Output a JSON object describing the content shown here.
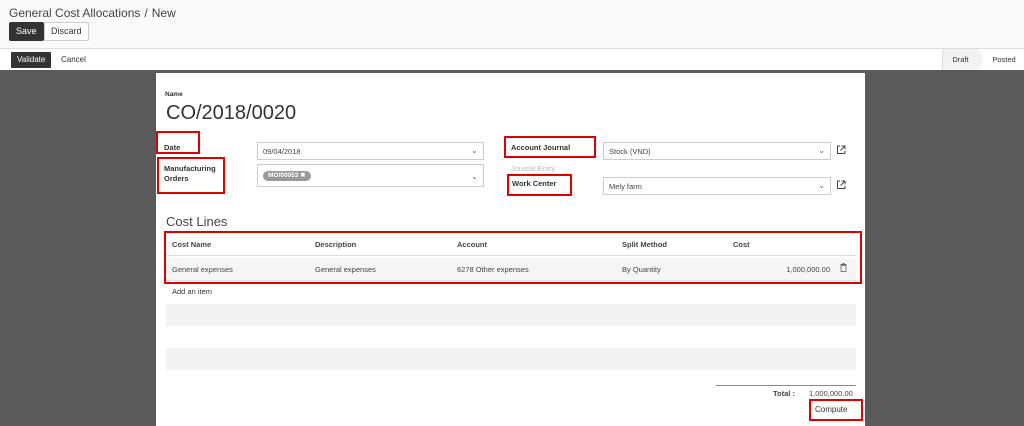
{
  "breadcrumb": {
    "parent": "General Cost Allocations",
    "separator": "/",
    "current": "New"
  },
  "buttons": {
    "save": "Save",
    "discard": "Discard",
    "validate": "Validate",
    "cancel": "Cancel",
    "compute": "Compute"
  },
  "status_stages": [
    "Draft",
    "Posted"
  ],
  "form": {
    "name_label": "Name",
    "name_value": "CO/2018/0020",
    "date_label": "Date",
    "date_value": "09/04/2018",
    "mo_label_line1": "Manufacturing",
    "mo_label_line2": "Orders",
    "mo_tag": "MO/00053",
    "account_journal_label": "Account Journal",
    "account_journal_value": "Stock (VND)",
    "journal_entry_label": "Journal Entry",
    "work_center_label": "Work Center",
    "work_center_value": "Mely farm"
  },
  "cost_lines": {
    "title": "Cost Lines",
    "columns": [
      "Cost Name",
      "Description",
      "Account",
      "Split Method",
      "Cost"
    ],
    "rows": [
      {
        "cost_name": "General expenses",
        "description": "General expenses",
        "account": "6278 Other expenses",
        "split_method": "By Quantity",
        "cost": "1,000,000.00"
      }
    ],
    "add_item": "Add an item"
  },
  "totals": {
    "label": "Total :",
    "value": "1,000,000.00"
  },
  "icons": {
    "caret": "chevron-down-icon",
    "external": "external-link-icon",
    "trash": "trash-icon",
    "tag_remove": "close-icon"
  },
  "colors": {
    "highlight": "#e00000",
    "dark_button": "#333333",
    "backdrop": "#5a5a5a"
  }
}
